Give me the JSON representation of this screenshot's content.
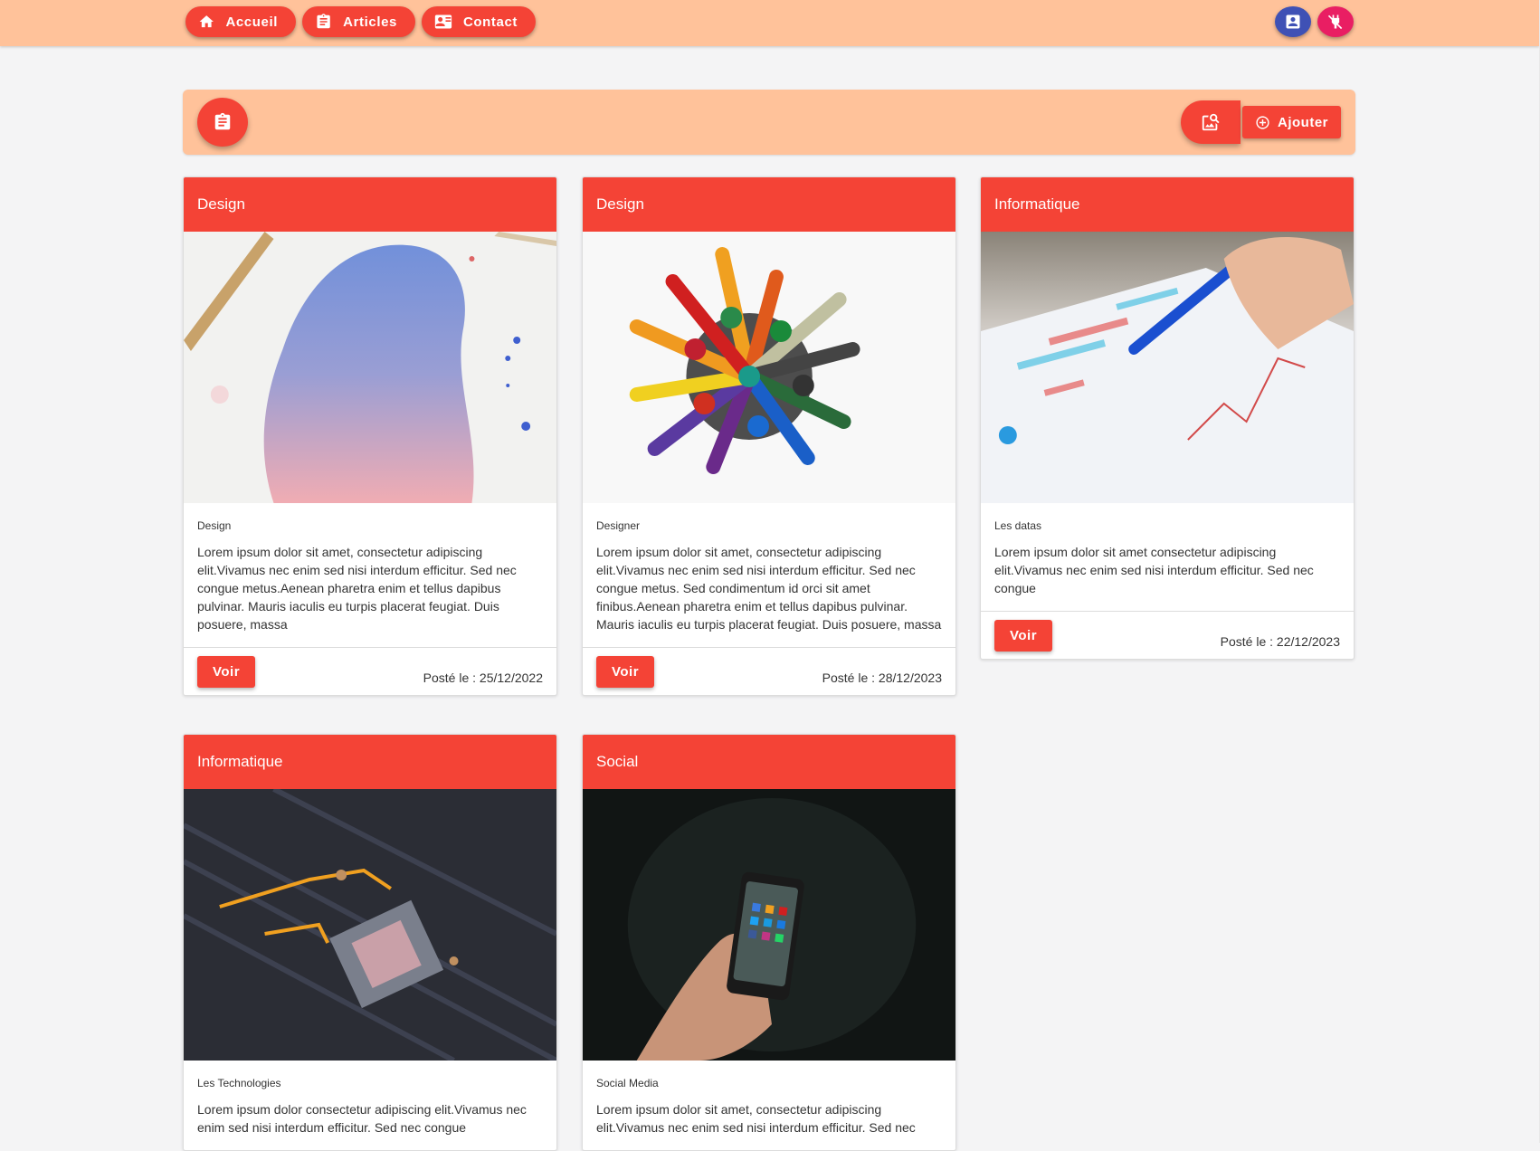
{
  "nav": {
    "items": [
      {
        "label": "Accueil",
        "icon": "home-icon"
      },
      {
        "label": "Articles",
        "icon": "clipboard-icon"
      },
      {
        "label": "Contact",
        "icon": "contact-card-icon"
      }
    ],
    "profile_icon": "account-box-icon",
    "logout_icon": "power-off-icon"
  },
  "toolbar": {
    "articles_icon": "clipboard-icon",
    "manage_icon": "image-search-icon",
    "add_label": "Ajouter"
  },
  "colors": {
    "accent": "#f44336",
    "header_bg": "#ffc29a",
    "profile": "#3f51b5",
    "logout": "#e91e63",
    "page_bg": "#f4f4f5"
  },
  "articles": [
    {
      "title": "Design",
      "image": "watercolor-paint-image",
      "category": "Design",
      "text": "Lorem ipsum dolor sit amet, consectetur adipiscing elit.Vivamus nec enim sed nisi interdum efficitur. Sed nec congue metus.Aenean pharetra enim et tellus dapibus pulvinar. Mauris iaculis eu turpis placerat feugiat. Duis posuere, massa",
      "button": "Voir",
      "date": "Posté le : 25/12/2022"
    },
    {
      "title": "Design",
      "image": "colored-pencils-image",
      "category": "Designer",
      "text": "Lorem ipsum dolor sit amet, consectetur adipiscing elit.Vivamus nec enim sed nisi interdum efficitur. Sed nec congue metus. Sed condimentum id orci sit amet finibus.Aenean pharetra enim et tellus dapibus pulvinar. Mauris iaculis eu turpis placerat feugiat. Duis posuere, massa",
      "button": "Voir",
      "date": "Posté le : 28/12/2023"
    },
    {
      "title": "Informatique",
      "image": "data-charts-pen-image",
      "category": "Les datas",
      "text": "Lorem ipsum dolor sit amet consectetur adipiscing elit.Vivamus nec enim sed nisi interdum efficitur. Sed nec congue",
      "button": "Voir",
      "date": "Posté le : 22/12/2023"
    },
    {
      "title": "Informatique",
      "image": "motherboard-cpu-socket-image",
      "category": "Les Technologies",
      "text": "Lorem ipsum dolor consectetur adipiscing elit.Vivamus nec enim sed nisi interdum efficitur. Sed nec congue"
    },
    {
      "title": "Social",
      "image": "smartphone-in-hand-image",
      "category": "Social Media",
      "text": "Lorem ipsum dolor sit amet, consectetur adipiscing elit.Vivamus nec enim sed nisi interdum efficitur. Sed nec"
    }
  ]
}
